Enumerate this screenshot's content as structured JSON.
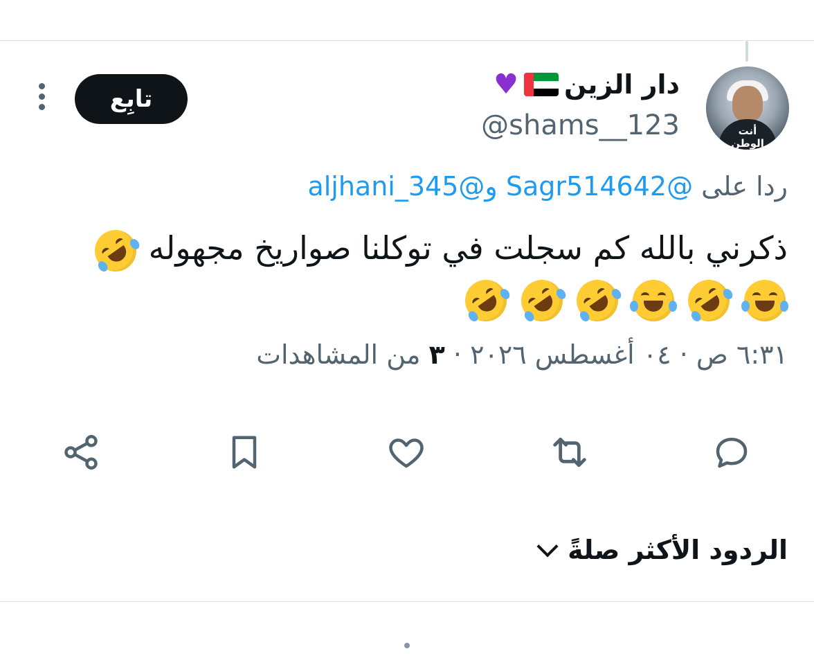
{
  "previous_tweet_fragment": "",
  "author": {
    "display_name": "دار الزين",
    "flag_icon": "uae-flag-icon",
    "heart_icon": "purple-heart-icon",
    "heart_color": "#8a2fd0",
    "handle": "@shams__123",
    "avatar_caption": "أنت الوطن"
  },
  "follow_button": {
    "label": "تابِع"
  },
  "reply_context": {
    "prefix": "ردا على",
    "mention_1": "@Sagr514642",
    "connector": "و",
    "mention_2": "@aljhani_345"
  },
  "tweet": {
    "text_line_1": "ذكرني بالله كم سجلت في توكلنا صواريخ مجهوله",
    "emoji_row": [
      "rolling-on-floor-laughing",
      "face-with-tears-of-joy",
      "rolling-on-floor-laughing",
      "face-with-tears-of-joy",
      "rolling-on-floor-laughing",
      "rolling-on-floor-laughing",
      "rolling-on-floor-laughing"
    ]
  },
  "meta": {
    "time": "٦:٣١ ص",
    "separator": "·",
    "date": "٠٤ أغسطس ٢٠٢٦",
    "views_separator": "·",
    "views_count": "٣",
    "views_label": "من المشاهدات"
  },
  "actions": [
    {
      "name": "reply",
      "icon": "reply-icon"
    },
    {
      "name": "retweet",
      "icon": "retweet-icon"
    },
    {
      "name": "like",
      "icon": "heart-icon"
    },
    {
      "name": "bookmark",
      "icon": "bookmark-icon"
    },
    {
      "name": "share",
      "icon": "share-icon"
    }
  ],
  "replies_sort": {
    "label": "الردود الأكثر صلةً",
    "icon": "chevron-down-icon"
  },
  "colors": {
    "link": "#1d9bf0",
    "secondary_text": "#536471",
    "primary_text": "#0f1419",
    "button_bg": "#0f1419"
  }
}
